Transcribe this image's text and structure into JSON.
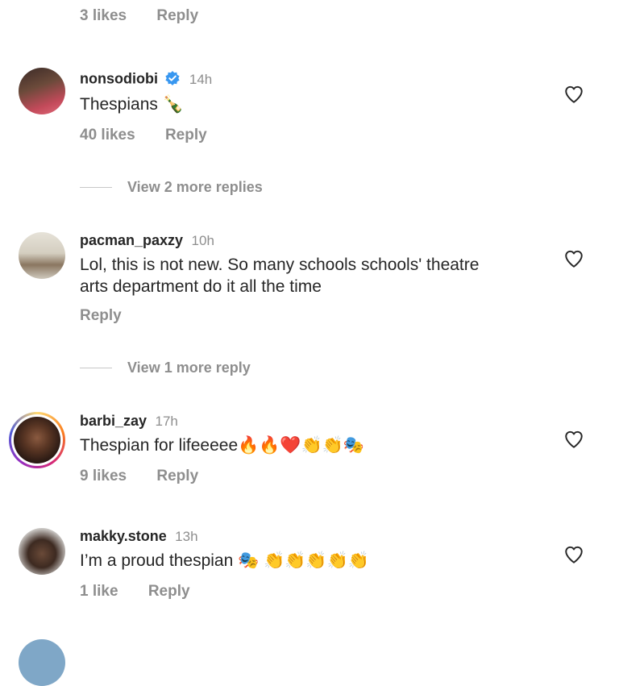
{
  "top_partial": {
    "likes": "3 likes",
    "reply": "Reply"
  },
  "comments": [
    {
      "username": "nonsodiobi",
      "verified": true,
      "time": "14h",
      "text": "Thespians 🍾",
      "likes": "40 likes",
      "reply": "Reply",
      "view_more": "View 2 more replies",
      "avatar_colors": [
        "#c34a5a",
        "#3b2a27"
      ]
    },
    {
      "username": "pacman_paxzy",
      "verified": false,
      "time": "10h",
      "text_lines": [
        "Lol, this is not new. So many schools schools' theatre",
        "arts department do it all the time"
      ],
      "reply": "Reply",
      "view_more": "View 1 more reply",
      "avatar_colors": [
        "#d9d4c8",
        "#7a6a56"
      ]
    },
    {
      "username": "barbi_zay",
      "verified": false,
      "time": "17h",
      "text": "Thespian for lifeeeee🔥🔥❤️👏👏🎭",
      "likes": "9 likes",
      "reply": "Reply",
      "avatar_colors": [
        "#2b1a14",
        "#6b4430"
      ],
      "story_ring": true
    },
    {
      "username": "makky.stone",
      "verified": false,
      "time": "13h",
      "text": "I’m a proud thespian 🎭 👏👏👏👏👏",
      "likes": "1 like",
      "reply": "Reply",
      "avatar_colors": [
        "#b7b3b0",
        "#3d2a21"
      ]
    }
  ],
  "colors": {
    "text": "#262626",
    "secondary": "#8e8e8e",
    "verified": "#3897f0"
  },
  "icons": {
    "like": "heart-outline-icon",
    "verified": "verified-badge-icon"
  }
}
